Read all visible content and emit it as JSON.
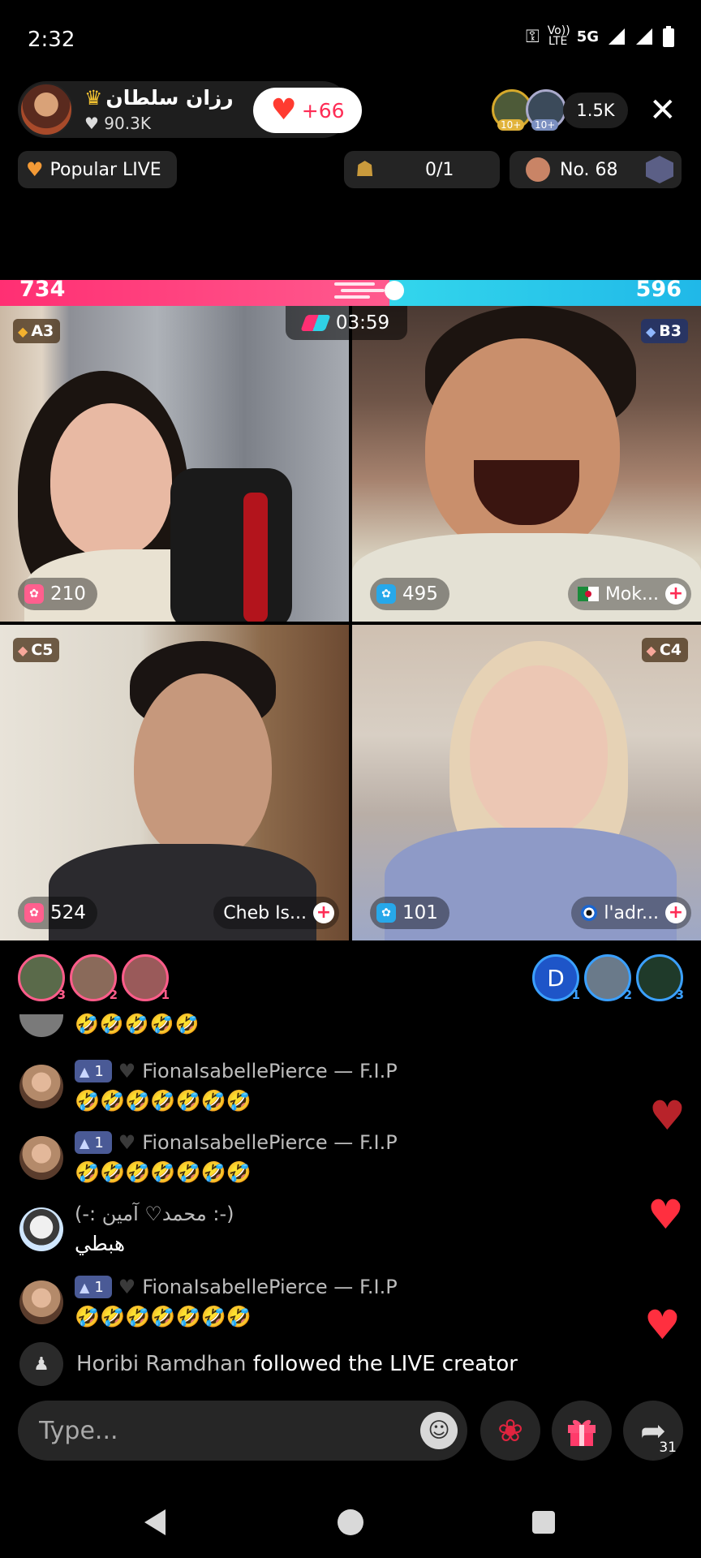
{
  "status": {
    "time": "2:32",
    "volte": "Vo)) LTE",
    "network": "5G"
  },
  "host": {
    "name": "رزان سلطان",
    "likes": "90.3K",
    "follow_count": "+66"
  },
  "viewers": {
    "count": "1.5K",
    "badges": [
      "10+",
      "10+"
    ]
  },
  "pills": {
    "popular": "Popular LIVE",
    "goal": "0/1",
    "rank": "No. 68"
  },
  "battle": {
    "left_score": "734",
    "right_score": "596",
    "timer": "03:59"
  },
  "tiles": [
    {
      "rank": "A3",
      "score": "210",
      "name": ""
    },
    {
      "rank": "B3",
      "score": "495",
      "name": "Mok..."
    },
    {
      "rank": "C5",
      "score": "524",
      "name": "Cheb Is..."
    },
    {
      "rank": "C4",
      "score": "101",
      "name": "l'adr..."
    }
  ],
  "supporters": {
    "left": [
      "3",
      "2",
      "1"
    ],
    "right": [
      {
        "letter": "D",
        "rank": "1"
      },
      {
        "letter": "",
        "rank": "2"
      },
      {
        "letter": "",
        "rank": "3"
      }
    ]
  },
  "chat": {
    "top_emojis": "🤣🤣🤣🤣🤣",
    "messages": [
      {
        "level": "1",
        "user": "FionaIsabellePierce — F.I.P",
        "text": "🤣🤣🤣🤣🤣🤣🤣"
      },
      {
        "level": "1",
        "user": "FionaIsabellePierce — F.I.P",
        "text": "🤣🤣🤣🤣🤣🤣🤣"
      },
      {
        "user": "(-: محمد♡ آمين :-)",
        "text": "هبطي"
      },
      {
        "level": "1",
        "user": "FionaIsabellePierce — F.I.P",
        "text": "🤣🤣🤣🤣🤣🤣🤣"
      }
    ],
    "follow_note": {
      "user": "Horibi Ramdhan",
      "action": "followed the LIVE creator"
    }
  },
  "composer": {
    "placeholder": "Type...",
    "share_count": "31"
  },
  "icons": {
    "close": "close-icon",
    "heart": "heart-icon",
    "crown": "crown-icon",
    "gift": "gift-icon",
    "rose": "rose-icon",
    "share": "share-icon",
    "emoji": "emoji-icon"
  },
  "colors": {
    "battle_left": "#ff2f73",
    "battle_right": "#2fd0e6",
    "accent": "#fe2c55"
  }
}
